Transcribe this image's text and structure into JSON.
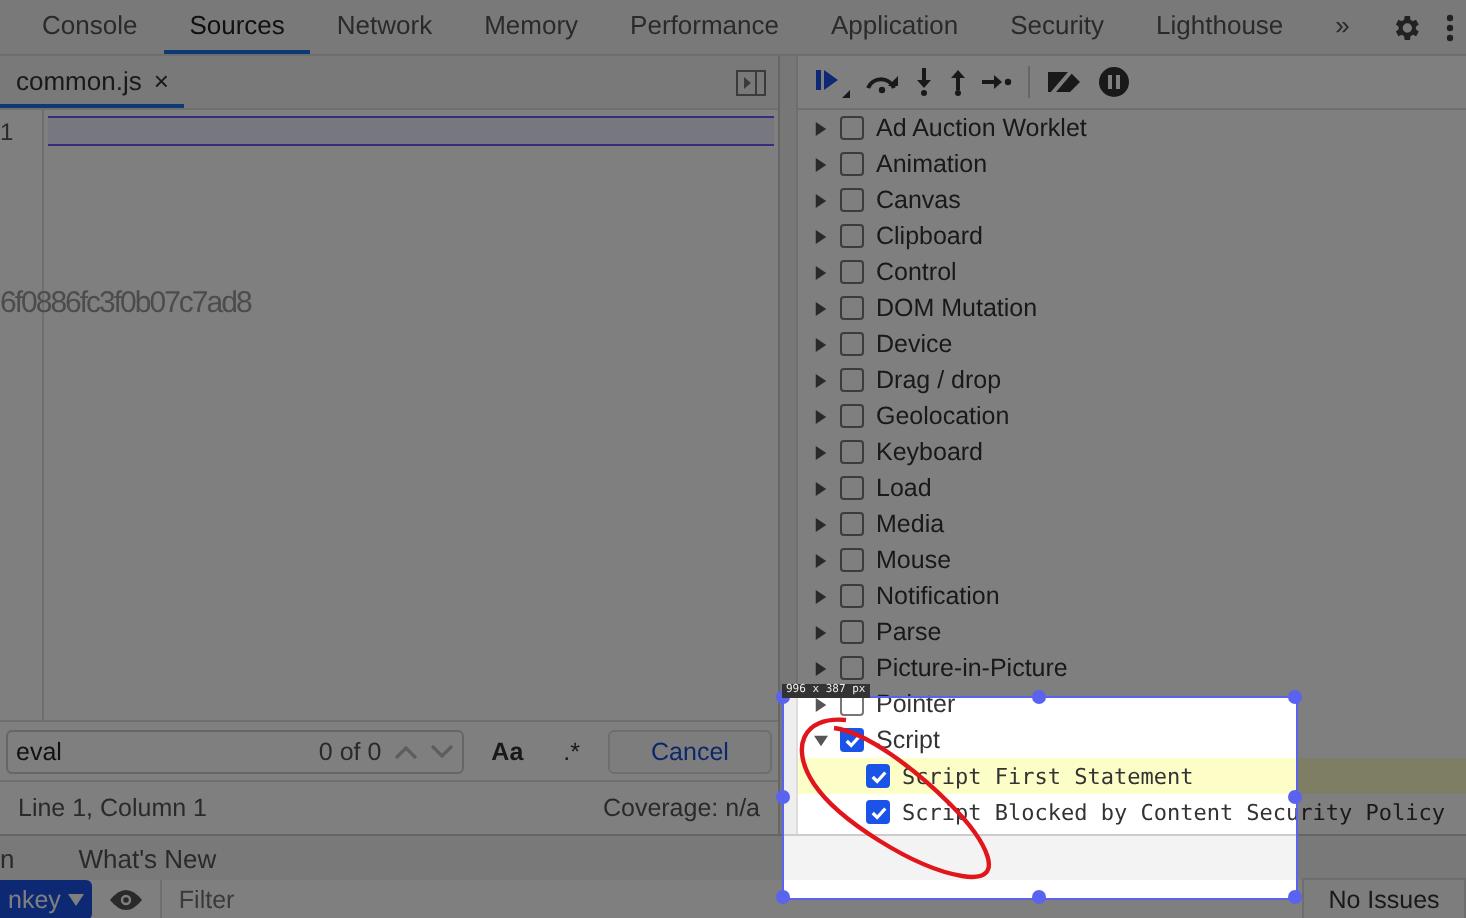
{
  "tabs": [
    {
      "label": "Console",
      "selected": false
    },
    {
      "label": "Sources",
      "selected": true
    },
    {
      "label": "Network",
      "selected": false
    },
    {
      "label": "Memory",
      "selected": false
    },
    {
      "label": "Performance",
      "selected": false
    },
    {
      "label": "Application",
      "selected": false
    },
    {
      "label": "Security",
      "selected": false
    },
    {
      "label": "Lighthouse",
      "selected": false
    }
  ],
  "more_tabs": "»",
  "editor": {
    "file_tabs": [
      {
        "label": "common.js",
        "selected": true,
        "close": "×"
      }
    ],
    "line_numbers": [
      "1"
    ],
    "ghost_text": "6f0886fc3f0b07c7ad8"
  },
  "search": {
    "value": "eval",
    "match_count": "0 of 0",
    "case_toggle": "Aa",
    "regex_toggle": ".*",
    "cancel": "Cancel"
  },
  "status": {
    "position": "Line 1, Column 1",
    "coverage": "Coverage: n/a"
  },
  "breakpoints": [
    {
      "label": "Ad Auction Worklet",
      "checked": false,
      "expanded": false
    },
    {
      "label": "Animation",
      "checked": false,
      "expanded": false
    },
    {
      "label": "Canvas",
      "checked": false,
      "expanded": false
    },
    {
      "label": "Clipboard",
      "checked": false,
      "expanded": false
    },
    {
      "label": "Control",
      "checked": false,
      "expanded": false
    },
    {
      "label": "DOM Mutation",
      "checked": false,
      "expanded": false
    },
    {
      "label": "Device",
      "checked": false,
      "expanded": false
    },
    {
      "label": "Drag / drop",
      "checked": false,
      "expanded": false
    },
    {
      "label": "Geolocation",
      "checked": false,
      "expanded": false
    },
    {
      "label": "Keyboard",
      "checked": false,
      "expanded": false
    },
    {
      "label": "Load",
      "checked": false,
      "expanded": false
    },
    {
      "label": "Media",
      "checked": false,
      "expanded": false
    },
    {
      "label": "Mouse",
      "checked": false,
      "expanded": false
    },
    {
      "label": "Notification",
      "checked": false,
      "expanded": false
    },
    {
      "label": "Parse",
      "checked": false,
      "expanded": false
    },
    {
      "label": "Picture-in-Picture",
      "checked": false,
      "expanded": false
    },
    {
      "label": "Pointer",
      "checked": false,
      "expanded": false
    },
    {
      "label": "Script",
      "checked": true,
      "expanded": true,
      "children": [
        {
          "label": "Script First Statement",
          "checked": true,
          "selected": true
        },
        {
          "label": "Script Blocked by Content Security Policy",
          "checked": true,
          "selected": false
        }
      ]
    }
  ],
  "drawer_tabs": [
    {
      "label": "n",
      "selected": false
    },
    {
      "label": "What's New",
      "selected": false
    }
  ],
  "console_toolbar": {
    "context": "nkey",
    "filter_placeholder": "Filter",
    "issues": "No Issues"
  },
  "selection": {
    "size_label": "996 x 387 px"
  }
}
